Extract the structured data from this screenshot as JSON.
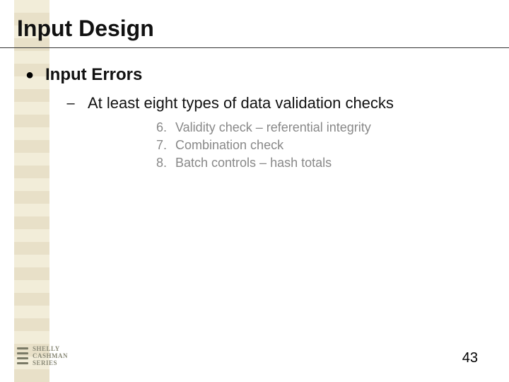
{
  "title": "Input Design",
  "bullet": {
    "label": "Input Errors",
    "sub": {
      "label": "At least eight types of data validation checks",
      "items": [
        {
          "num": "6.",
          "text": "Validity check – referential integrity"
        },
        {
          "num": "7.",
          "text": "Combination check"
        },
        {
          "num": "8.",
          "text": "Batch controls – hash totals"
        }
      ]
    }
  },
  "logo": {
    "line1": "SHELLY",
    "line2": "CASHMAN",
    "line3": "SERIES"
  },
  "page_number": "43"
}
